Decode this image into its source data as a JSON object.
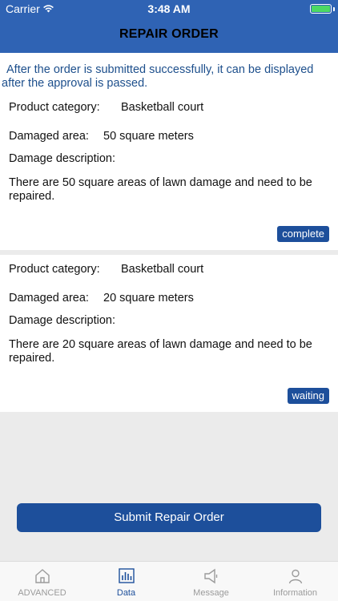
{
  "status_bar": {
    "carrier": "Carrier",
    "time": "3:48 AM"
  },
  "header": {
    "title": "REPAIR ORDER"
  },
  "notice": {
    "text": "After the order is submitted successfully, it can be displayed after the approval is passed."
  },
  "orders": [
    {
      "category_label": "Product category:",
      "category_value": "Basketball court",
      "area_label": "Damaged area:",
      "area_value": "50 square meters",
      "description_label": "Damage description:",
      "description_text": "There are 50 square areas of lawn damage and need to be repaired.",
      "status": "complete"
    },
    {
      "category_label": "Product category:",
      "category_value": "Basketball court",
      "area_label": "Damaged area:",
      "area_value": "20 square meters",
      "description_label": "Damage description:",
      "description_text": "There are 20 square areas of lawn damage and need to be repaired.",
      "status": "waiting"
    }
  ],
  "submit_button": {
    "label": "Submit Repair Order"
  },
  "tabbar": {
    "tabs": [
      {
        "label": "ADVANCED",
        "icon": "home-icon"
      },
      {
        "label": "Data",
        "icon": "bar-chart-icon",
        "active": true
      },
      {
        "label": "Message",
        "icon": "megaphone-icon"
      },
      {
        "label": "Information",
        "icon": "person-icon"
      }
    ]
  },
  "colors": {
    "header": "#2f63b4",
    "accent": "#1d4f9b",
    "notice_text": "#1d4f8c",
    "battery": "#4cd964"
  }
}
